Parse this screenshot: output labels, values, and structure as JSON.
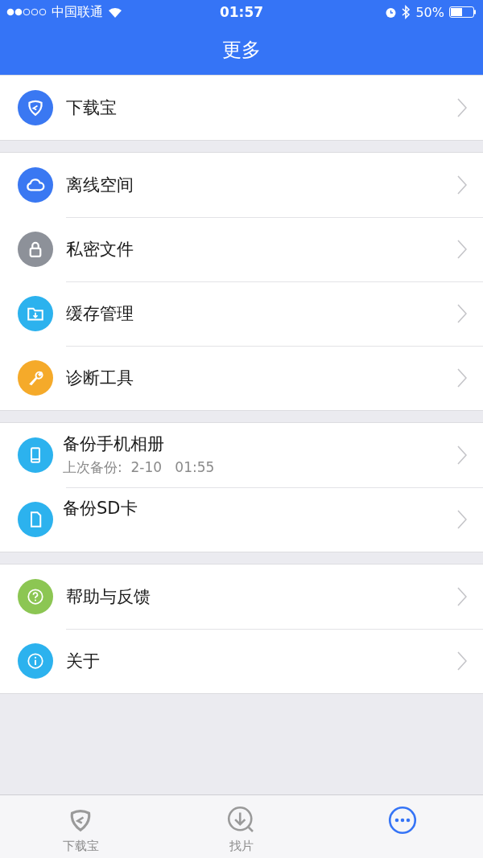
{
  "status_bar": {
    "carrier": "中国联通",
    "time": "01:57",
    "battery": "50%"
  },
  "nav_bar": {
    "title": "更多"
  },
  "groups": [
    {
      "kind": "menu",
      "rows": [
        {
          "kind": "shield",
          "title": "下载宝"
        }
      ]
    },
    {
      "kind": "menu",
      "rows": [
        {
          "kind": "cloud",
          "title": "离线空间"
        },
        {
          "kind": "lock",
          "title": "私密文件"
        },
        {
          "kind": "folder",
          "title": "缓存管理"
        },
        {
          "kind": "wrench",
          "title": "诊断工具"
        }
      ]
    },
    {
      "kind": "backup",
      "rows": [
        {
          "kind": "phone",
          "title": "备份手机相册",
          "subtitle": "上次备份:  2-10   01:55"
        },
        {
          "kind": "card",
          "title": "备份SD卡"
        }
      ]
    },
    {
      "kind": "menu",
      "rows": [
        {
          "kind": "help",
          "title": "帮助与反馈"
        },
        {
          "kind": "info",
          "title": "关于"
        }
      ]
    }
  ],
  "tab_bar": [
    {
      "kind": "shield",
      "label": "下载宝",
      "selected": false
    },
    {
      "kind": "download",
      "label": "找片",
      "selected": false
    },
    {
      "kind": "more",
      "selected": true
    }
  ]
}
